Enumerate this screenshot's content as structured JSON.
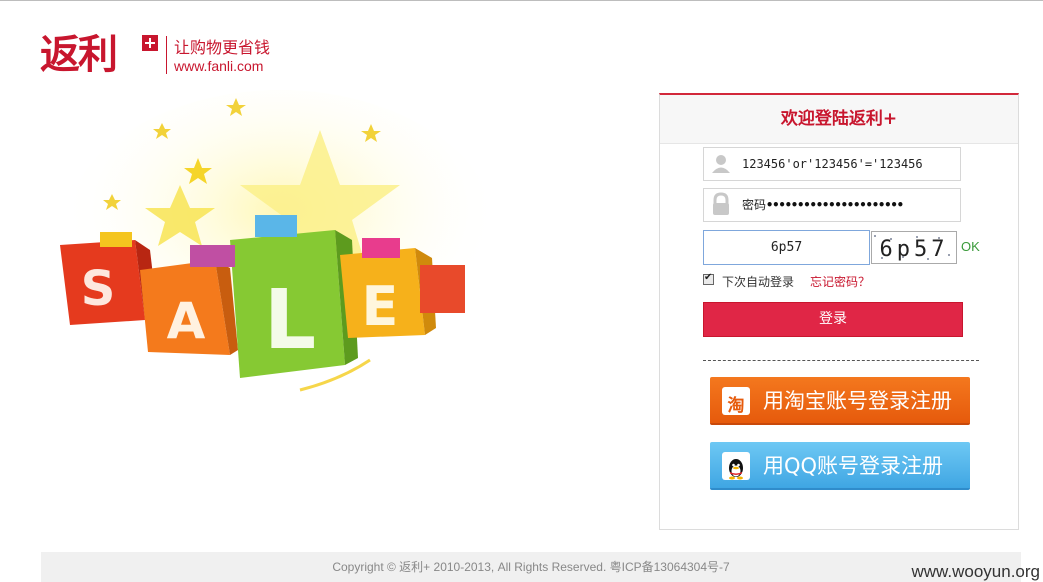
{
  "logo": {
    "mark": "返利",
    "slogan": "让购物更省钱",
    "url": "www.fanli.com"
  },
  "banner": {
    "letters": [
      "S",
      "A",
      "L",
      "E"
    ]
  },
  "login": {
    "title": "欢迎登陆返利+",
    "username_value": "123456'or'123456'='123456",
    "password_label": "密码",
    "password_dots": "••••••••••••••••••••••",
    "captcha_value": "6p57",
    "captcha_image_text": "6p57",
    "captcha_status": "OK",
    "remember_label": "下次自动登录",
    "remember_checked": true,
    "forgot_label": "忘记密码？",
    "login_button": "登录",
    "taobao_button": "用淘宝账号登录注册",
    "taobao_badge": "淘",
    "qq_button": "用QQ账号登录注册"
  },
  "footer": {
    "copyright": "Copyright © 返利+ 2010-2013, All Rights Reserved. 粤ICP备13064304号-7"
  },
  "watermark": "www.wooyun.org",
  "colors": {
    "brand_red": "#c8162e",
    "login_button": "#e02646",
    "taobao_orange": "#f06f18",
    "qq_blue": "#55b8ec"
  }
}
